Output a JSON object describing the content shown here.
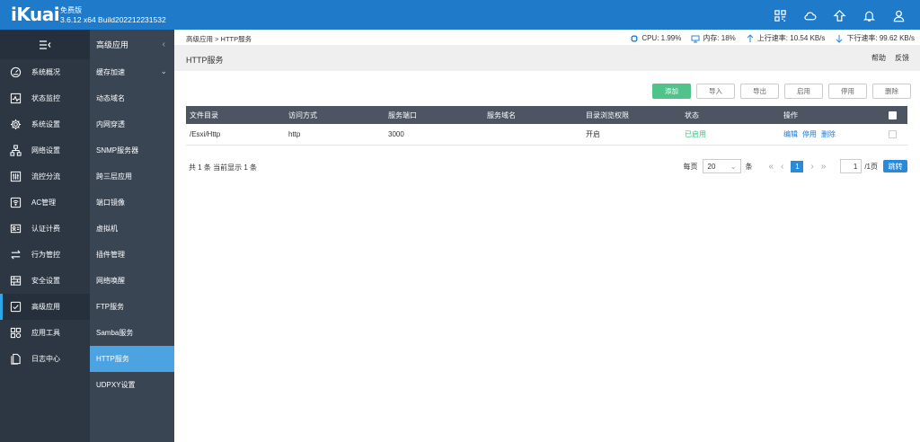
{
  "header": {
    "logo": "iKuai",
    "edition": "免费版",
    "version": "3.6.12 x64 Build202212231532",
    "icons": [
      "grid-icon",
      "cloud-icon",
      "upgrade-icon",
      "bell-icon",
      "user-icon"
    ]
  },
  "nav": {
    "items": [
      {
        "label": "系统概况",
        "icon": "dashboard-icon"
      },
      {
        "label": "状态监控",
        "icon": "monitor-icon"
      },
      {
        "label": "系统设置",
        "icon": "settings-icon"
      },
      {
        "label": "网络设置",
        "icon": "network-icon"
      },
      {
        "label": "流控分流",
        "icon": "flow-icon"
      },
      {
        "label": "AC管理",
        "icon": "wifi-icon"
      },
      {
        "label": "认证计费",
        "icon": "auth-icon"
      },
      {
        "label": "行为管控",
        "icon": "behavior-icon"
      },
      {
        "label": "安全设置",
        "icon": "security-icon"
      },
      {
        "label": "高级应用",
        "icon": "advanced-icon"
      },
      {
        "label": "应用工具",
        "icon": "tools-icon"
      },
      {
        "label": "日志中心",
        "icon": "log-icon"
      }
    ],
    "active_index": 9
  },
  "subnav": {
    "title": "高级应用",
    "items": [
      "缓存加速",
      "动态域名",
      "内网穿透",
      "SNMP服务器",
      "跨三层应用",
      "端口镜像",
      "虚拟机",
      "插件管理",
      "网络唤醒",
      "FTP服务",
      "Samba服务",
      "HTTP服务",
      "UDPXY设置"
    ],
    "active_index": 11
  },
  "status": {
    "breadcrumb": "高级应用 > HTTP服务",
    "cpu": "CPU: 1.99%",
    "memory": "内存: 18%",
    "upload": "上行速率: 10.54 KB/s",
    "download": "下行速率: 99.62 KB/s"
  },
  "page": {
    "title": "HTTP服务",
    "help": "帮助",
    "feedback": "反馈"
  },
  "toolbar": {
    "add": "添加",
    "import": "导入",
    "export": "导出",
    "enable": "启用",
    "disable": "停用",
    "delete": "删除"
  },
  "table": {
    "columns": [
      "文件目录",
      "访问方式",
      "服务端口",
      "服务域名",
      "目录浏览权限",
      "状态",
      "操作"
    ],
    "rows": [
      {
        "dir": "/Esxi/Http",
        "access": "http",
        "port": "3000",
        "domain": "",
        "browse": "开启",
        "status": "已启用",
        "actions": [
          "编辑",
          "停用",
          "删除"
        ]
      }
    ]
  },
  "pager": {
    "total": "共 1 条 当前显示 1 条",
    "per_page_label": "每页",
    "per_page": "20",
    "unit": "条",
    "current_page": "1",
    "page_input": "1",
    "total_pages": "/1页",
    "go": "跳转"
  },
  "colors": {
    "topbar": "#1f7ac9",
    "nav_bg": "#2d3744",
    "subnav_bg": "#3a4554",
    "active_sub": "#4ba3e2",
    "add_button": "#4fc389",
    "table_header": "#4c5561"
  }
}
